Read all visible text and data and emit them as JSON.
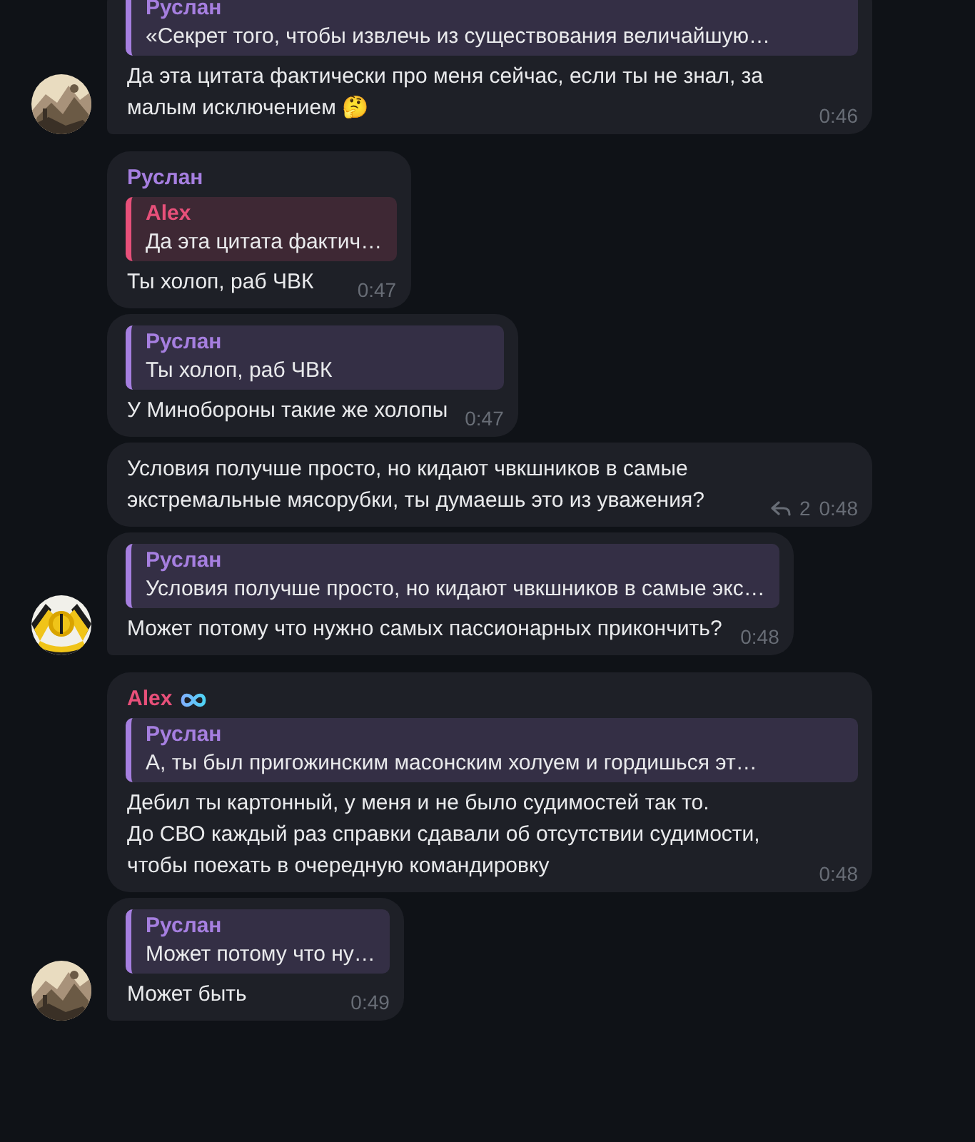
{
  "messages": [
    {
      "reply": {
        "name": "Руслан",
        "color": "#a67fe0",
        "text": "«Секрет того, чтобы извлечь из существования величайшую…"
      },
      "text": "Да эта цитата фактически про меня сейчас, если ты не знал, за малым исключением 🤔",
      "time": "0:46",
      "avatar": true
    },
    {
      "sender": {
        "name": "Руслан",
        "color": "#a67fe0",
        "badge": false
      },
      "reply": {
        "name": "Alex",
        "color": "#e8507a",
        "text": "Да эта цитата фактич…"
      },
      "text": "Ты холоп, раб ЧВК",
      "time": "0:47",
      "avatar": false
    },
    {
      "reply": {
        "name": "Руслан",
        "color": "#a67fe0",
        "text": "Ты холоп, раб ЧВК"
      },
      "text": "У Минобороны такие же холопы",
      "time": "0:47",
      "avatar": false
    },
    {
      "text": "Условия получше просто, но кидают чвкшников в самые экстремальные мясорубки, ты думаешь это из уважения?",
      "replies": "2",
      "time": "0:48",
      "avatar": false
    },
    {
      "reply": {
        "name": "Руслан",
        "color": "#a67fe0",
        "text": "Условия получше просто, но кидают чвкшников в самые экс…"
      },
      "text": "Может потому что нужно самых пассионарных прикончить?",
      "time": "0:48",
      "avatar": true
    },
    {
      "sender": {
        "name": "Alex",
        "color": "#e8507a",
        "badge": true
      },
      "reply": {
        "name": "Руслан",
        "color": "#a67fe0",
        "text": "А, ты был пригожинским масонским холуем и гордишься эт…"
      },
      "text": "Дебил ты картонный, у меня и не было судимостей так то.\nДо СВО каждый раз справки сдавали об отсутствии судимости, чтобы поехать в очередную командировку",
      "time": "0:48",
      "avatar": false
    },
    {
      "reply": {
        "name": "Руслан",
        "color": "#a67fe0",
        "text": "Может потому что ну…"
      },
      "text": "Может быть",
      "time": "0:49",
      "avatar": true
    }
  ]
}
